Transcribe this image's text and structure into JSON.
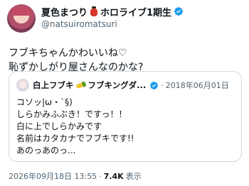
{
  "author": {
    "display_name": "夏色まつり",
    "org": "ホロライブ1期生",
    "handle": "@natsuiromatsuri"
  },
  "tweet": {
    "lines": [
      "フブキちゃんかわいいね♡",
      "恥ずかしがり屋さんなのかな?"
    ]
  },
  "quote": {
    "display_name": "白上フブキ",
    "org": "フブキングダ...",
    "separator": "·",
    "date": "2018年06月01日",
    "lines": [
      "コソッ|ω・`§)",
      "しらかみふぶき！ですっ！！",
      "白に上でしらかみです",
      "名前はカタカナでフブキです!!",
      "あのっあのっ..."
    ]
  },
  "meta": {
    "timestamp": "2026年09月18日 13:55",
    "separator": "·",
    "views": "7.4K",
    "views_label": "表示"
  },
  "colors": {
    "verified": "#1d9bf0",
    "text": "#0f1419",
    "muted": "#536471",
    "border": "#cfd9de"
  }
}
